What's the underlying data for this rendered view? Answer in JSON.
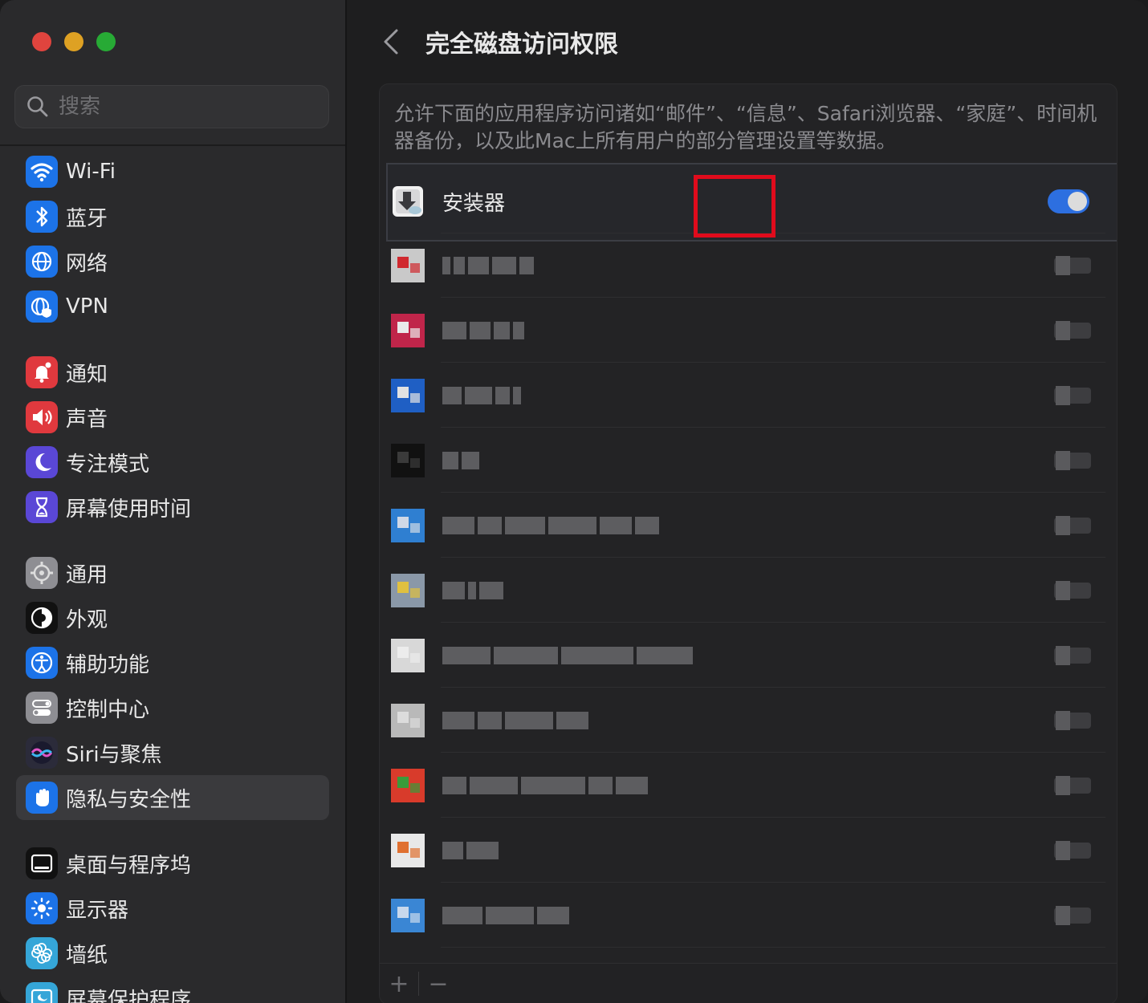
{
  "window": {
    "controls": [
      "close",
      "minimize",
      "zoom"
    ]
  },
  "sidebar": {
    "search_placeholder": "搜索",
    "groups": [
      [
        {
          "label": "Wi-Fi",
          "icon": "wifi-icon",
          "color": "#1c73e8"
        },
        {
          "label": "蓝牙",
          "icon": "bluetooth-icon",
          "color": "#1c73e8"
        },
        {
          "label": "网络",
          "icon": "globe-icon",
          "color": "#1c73e8"
        },
        {
          "label": "VPN",
          "icon": "vpn-icon",
          "color": "#1c73e8"
        }
      ],
      [
        {
          "label": "通知",
          "icon": "bell-icon",
          "color": "#e0393e"
        },
        {
          "label": "声音",
          "icon": "speaker-icon",
          "color": "#e0393e"
        },
        {
          "label": "专注模式",
          "icon": "moon-icon",
          "color": "#5a47d6"
        },
        {
          "label": "屏幕使用时间",
          "icon": "hourglass-icon",
          "color": "#5a47d6"
        }
      ],
      [
        {
          "label": "通用",
          "icon": "gear-icon",
          "color": "#8e8e93"
        },
        {
          "label": "外观",
          "icon": "appearance-icon",
          "color": "#111111"
        },
        {
          "label": "辅助功能",
          "icon": "accessibility-icon",
          "color": "#1c73e8"
        },
        {
          "label": "控制中心",
          "icon": "control-center-icon",
          "color": "#8e8e93"
        },
        {
          "label": "Siri与聚焦",
          "icon": "siri-icon",
          "color": "#2b2b3a"
        },
        {
          "label": "隐私与安全性",
          "icon": "hand-icon",
          "color": "#1c73e8",
          "active": true
        }
      ],
      [
        {
          "label": "桌面与程序坞",
          "icon": "dock-icon",
          "color": "#111111"
        },
        {
          "label": "显示器",
          "icon": "sun-icon",
          "color": "#1c73e8"
        },
        {
          "label": "墙纸",
          "icon": "flower-icon",
          "color": "#35a6d8"
        },
        {
          "label": "屏幕保护程序",
          "icon": "screensaver-icon",
          "color": "#35a6d8"
        }
      ]
    ]
  },
  "main": {
    "title": "完全磁盘访问权限",
    "description": "允许下面的应用程序访问诸如“邮件”、“信息”、Safari浏览器、“家庭”、时间机器备份，以及此Mac上所有用户的部分管理设置等数据。",
    "apps": [
      {
        "name": "安装器",
        "icon": "installer-icon",
        "enabled": true
      }
    ],
    "obscured_rows": 12,
    "bottom_buttons": {
      "add": "+",
      "remove": "−"
    }
  },
  "colors": {
    "accent": "#2d6fe0",
    "highlight_box": "#e00b1c"
  }
}
